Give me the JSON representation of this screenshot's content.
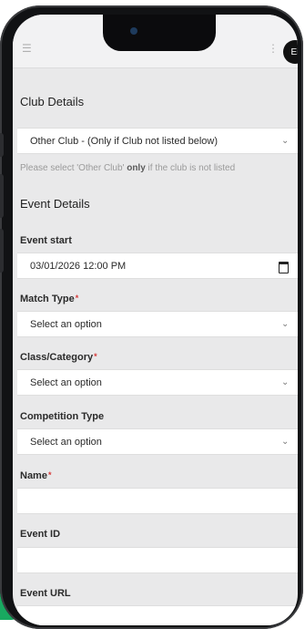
{
  "header": {
    "avatar_text": "Ei"
  },
  "club_details": {
    "title": "Club Details",
    "select_value": "Other Club - (Only if Club not listed below)",
    "help_pre": "Please select 'Other Club' ",
    "help_bold": "only",
    "help_post": " if the club is not listed"
  },
  "event_details": {
    "title": "Event Details",
    "event_start_label": "Event start",
    "event_start_value": "03/01/2026  12:00  PM",
    "match_type_label": "Match Type",
    "match_type_value": "Select an option",
    "class_label": "Class/Category",
    "class_value": "Select an option",
    "competition_label": "Competition Type",
    "competition_value": "Select an option",
    "name_label": "Name",
    "name_value": "",
    "event_id_label": "Event ID",
    "event_id_value": "",
    "event_url_label": "Event URL",
    "required_mark": "*"
  },
  "colors": {
    "accent_green": "#19a960",
    "required": "#d63a3a"
  }
}
